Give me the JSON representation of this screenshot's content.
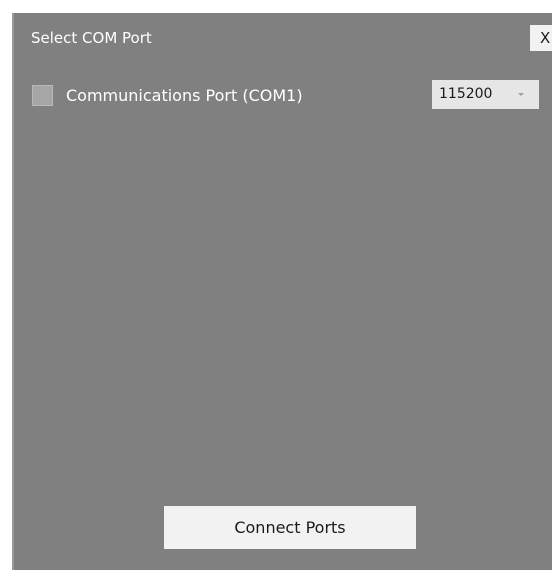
{
  "dialog": {
    "title": "Select COM Port",
    "close_label": "X"
  },
  "ports": [
    {
      "label": "Communications Port (COM1)",
      "checked": false,
      "baud_rate": "115200"
    }
  ],
  "footer": {
    "connect_label": "Connect Ports"
  },
  "colors": {
    "dialog_background": "#808080",
    "button_background": "#f2f2f2",
    "text_light": "#ffffff"
  }
}
